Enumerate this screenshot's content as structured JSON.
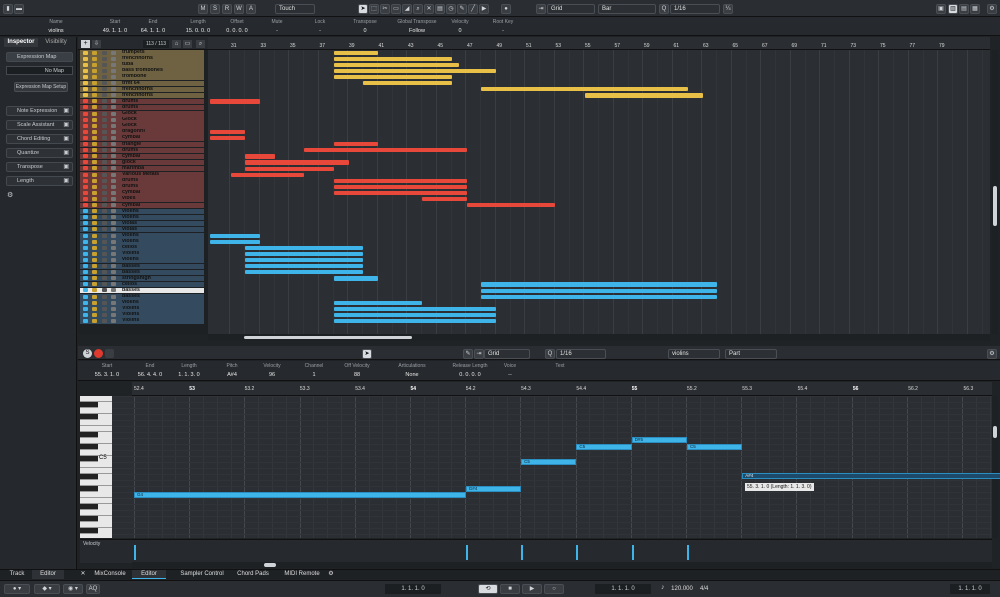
{
  "toolbar": {
    "mode_buttons": [
      "M",
      "S",
      "R",
      "W",
      "A"
    ],
    "automation_mode": "Touch",
    "snap_type": "Grid",
    "grid_type": "Bar",
    "quantize": "1/16"
  },
  "info_line": {
    "headers": [
      "Name",
      "Start",
      "End",
      "Length",
      "Offset",
      "Mute",
      "Lock",
      "Transpose",
      "Global Transpose",
      "Velocity",
      "Root Key"
    ],
    "values": [
      "violins",
      "49. 1. 1.   0",
      "64. 1. 1.   0",
      "15. 0. 0.   0",
      "0. 0. 0.   0",
      "-",
      "-",
      "0",
      "Follow",
      "0",
      "-"
    ]
  },
  "inspector": {
    "tabs": [
      "Inspector",
      "Visibility"
    ],
    "expression_map": "Expression Map",
    "no_map": "No Map",
    "expression_map_setup": "Expression Map Setup",
    "sections": [
      "Note Expression",
      "Scale Assistant",
      "Chord Editing",
      "Quantize",
      "Transpose",
      "Length"
    ]
  },
  "track_list": {
    "counter": "113 / 113",
    "tracks": [
      {
        "name": "trumpets",
        "group": "brass"
      },
      {
        "name": "frenchhorns",
        "group": "brass"
      },
      {
        "name": "tuba",
        "group": "brass"
      },
      {
        "name": "bass trombones",
        "group": "brass"
      },
      {
        "name": "trombone",
        "group": "brass"
      },
      {
        "name": "trmt 64",
        "group": "brass"
      },
      {
        "name": "frenchhorns",
        "group": "brass"
      },
      {
        "name": "frenchhorns",
        "group": "brass"
      },
      {
        "name": "drums",
        "group": "perc"
      },
      {
        "name": "drums",
        "group": "perc"
      },
      {
        "name": "Glock",
        "group": "perc"
      },
      {
        "name": "Glock",
        "group": "perc"
      },
      {
        "name": "Glock",
        "group": "perc"
      },
      {
        "name": "dragonril",
        "group": "perc"
      },
      {
        "name": "cymbal",
        "group": "perc"
      },
      {
        "name": "triangle",
        "group": "perc"
      },
      {
        "name": "drums",
        "group": "perc"
      },
      {
        "name": "cymbal",
        "group": "perc"
      },
      {
        "name": "glock",
        "group": "perc"
      },
      {
        "name": "marimba",
        "group": "perc"
      },
      {
        "name": "Various Metals",
        "group": "perc"
      },
      {
        "name": "drums",
        "group": "perc"
      },
      {
        "name": "drums",
        "group": "perc"
      },
      {
        "name": "cymbal",
        "group": "perc"
      },
      {
        "name": "vibes",
        "group": "perc"
      },
      {
        "name": "cymbal",
        "group": "perc"
      },
      {
        "name": "violins",
        "group": "str"
      },
      {
        "name": "violins",
        "group": "str"
      },
      {
        "name": "violas",
        "group": "str"
      },
      {
        "name": "violas",
        "group": "str"
      },
      {
        "name": "violins",
        "group": "str"
      },
      {
        "name": "violins",
        "group": "str"
      },
      {
        "name": "celios",
        "group": "str"
      },
      {
        "name": "Violins",
        "group": "str"
      },
      {
        "name": "violins",
        "group": "str"
      },
      {
        "name": "basses",
        "group": "str"
      },
      {
        "name": "basses",
        "group": "str"
      },
      {
        "name": "stringshigh",
        "group": "str"
      },
      {
        "name": "celios",
        "group": "str"
      },
      {
        "name": "basses",
        "group": "str"
      },
      {
        "name": "basses",
        "group": "str"
      },
      {
        "name": "violins",
        "group": "str"
      },
      {
        "name": "Violins",
        "group": "str"
      },
      {
        "name": "Violins",
        "group": "str"
      },
      {
        "name": "Violins",
        "group": "str"
      }
    ]
  },
  "arrange_ruler": [
    "31",
    "33",
    "35",
    "37",
    "39",
    "41",
    "43",
    "45",
    "47",
    "49",
    "51",
    "53",
    "55",
    "57",
    "59",
    "61",
    "63",
    "65",
    "67",
    "69",
    "71",
    "73",
    "75",
    "77",
    "79"
  ],
  "colors": {
    "brass": "#e8c048",
    "perc": "#e8483a",
    "str": "#3fb4e8",
    "brass_bg": "#6e6242",
    "perc_bg": "#6a3a3a",
    "str_bg": "#344a5e"
  },
  "editor": {
    "snap_type": "Grid",
    "quantize": "1/16",
    "track": "violins",
    "part": "Part",
    "info_headers": [
      "Start",
      "End",
      "Length",
      "Pitch",
      "Velocity",
      "Channel",
      "Off Velocity",
      "Articulations",
      "Release Length",
      "Voice",
      "Text"
    ],
    "info_values": [
      "55. 3. 1.   0",
      "56. 4. 4.   0",
      "1. 1. 3.   0",
      "A#4",
      "96",
      "1",
      "88",
      "None",
      "0. 0. 0.   0",
      "--",
      ""
    ],
    "ruler": [
      "52.4",
      "53",
      "53.2",
      "53.3",
      "53.4",
      "54",
      "54.2",
      "54.3",
      "54.4",
      "55",
      "55.2",
      "55.3",
      "55.4",
      "56",
      "56.2",
      "56.3",
      "56.4"
    ],
    "key_label": "C5",
    "notes": [
      {
        "label": "G4"
      },
      {
        "label": "G#4"
      },
      {
        "label": "C5"
      },
      {
        "label": "C5"
      },
      {
        "label": "D#5"
      },
      {
        "label": "C5"
      },
      {
        "label": "A#4"
      }
    ],
    "tooltip": "55. 3. 1.  0 (Length: 1. 1. 3.  0)",
    "velocity_label": "Velocity"
  },
  "bottom_tabs": {
    "left": [
      "Track",
      "Editor"
    ],
    "right": [
      "MixConsole",
      "Editor",
      "Sampler Control",
      "Chord Pads",
      "MIDI Remote"
    ]
  },
  "transport": {
    "left_locator": "1. 1. 1.   0",
    "right_locator": "1. 1. 1.   0",
    "position": "1. 1. 1.   0",
    "tempo": "120.000",
    "signature": "4/4"
  }
}
